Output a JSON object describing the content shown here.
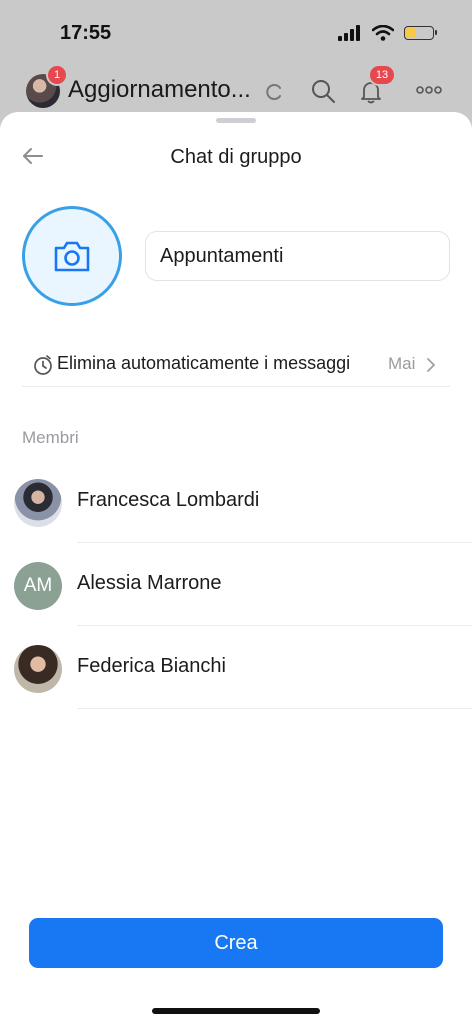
{
  "status_bar": {
    "time": "17:55",
    "battery_level": 0.35
  },
  "background_header": {
    "title": "Aggiornamento...",
    "avatar_badge": "1",
    "notifications_badge": "13"
  },
  "sheet": {
    "title": "Chat di gruppo",
    "group_name_value": "Appuntamenti",
    "auto_delete": {
      "label": "Elimina automaticamente i messaggi",
      "value": "Mai"
    },
    "members_label": "Membri",
    "members": [
      {
        "name": "Francesca Lombardi",
        "avatar_type": "photo"
      },
      {
        "name": "Alessia Marrone",
        "avatar_type": "initials",
        "initials": "AM"
      },
      {
        "name": "Federica Bianchi",
        "avatar_type": "photo"
      }
    ],
    "create_label": "Crea"
  },
  "colors": {
    "accent": "#1877f2",
    "photo_ring": "#3aa0e6",
    "badge": "#e5484d"
  }
}
